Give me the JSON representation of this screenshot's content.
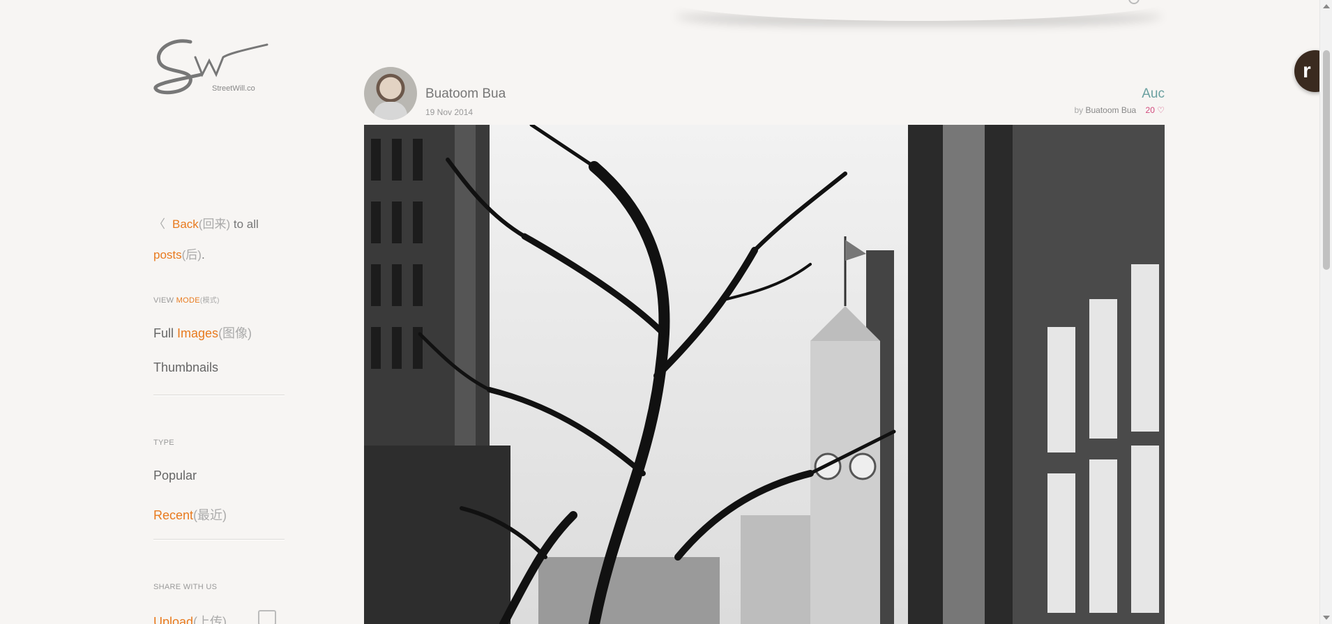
{
  "site": {
    "logo_text": "Sw",
    "logo_sub": "StreetWill.co"
  },
  "sidebar": {
    "back": {
      "back_label": "Back",
      "back_cn": "(回来)",
      "to_all": "to all",
      "posts_label": "posts",
      "posts_cn": "(后)",
      "period": "."
    },
    "view_mode": {
      "label_view": "VIEW",
      "label_mode": "MODE",
      "label_cn": "(模式)",
      "full_prefix": "Full",
      "full_highlight": "Images",
      "full_cn": "(图像)",
      "thumbnails": "Thumbnails"
    },
    "type": {
      "label": "TYPE",
      "popular": "Popular",
      "recent": "Recent",
      "recent_cn": "(最近)"
    },
    "share": {
      "label": "SHARE WITH US",
      "upload": "Upload",
      "upload_cn": "(上传)"
    }
  },
  "post": {
    "author": "Buatoom Bua",
    "date": "19 Nov 2014",
    "title": "Auc",
    "by_label": "by",
    "by_name": "Buatoom Bua",
    "likes": "20",
    "heart_icon": "heart-icon"
  },
  "floating_badge": {
    "letter": "r"
  },
  "colors": {
    "accent": "#e87a1e",
    "title": "#6aa0a0",
    "likes": "#d24b7c",
    "background": "#f7f5f3"
  }
}
